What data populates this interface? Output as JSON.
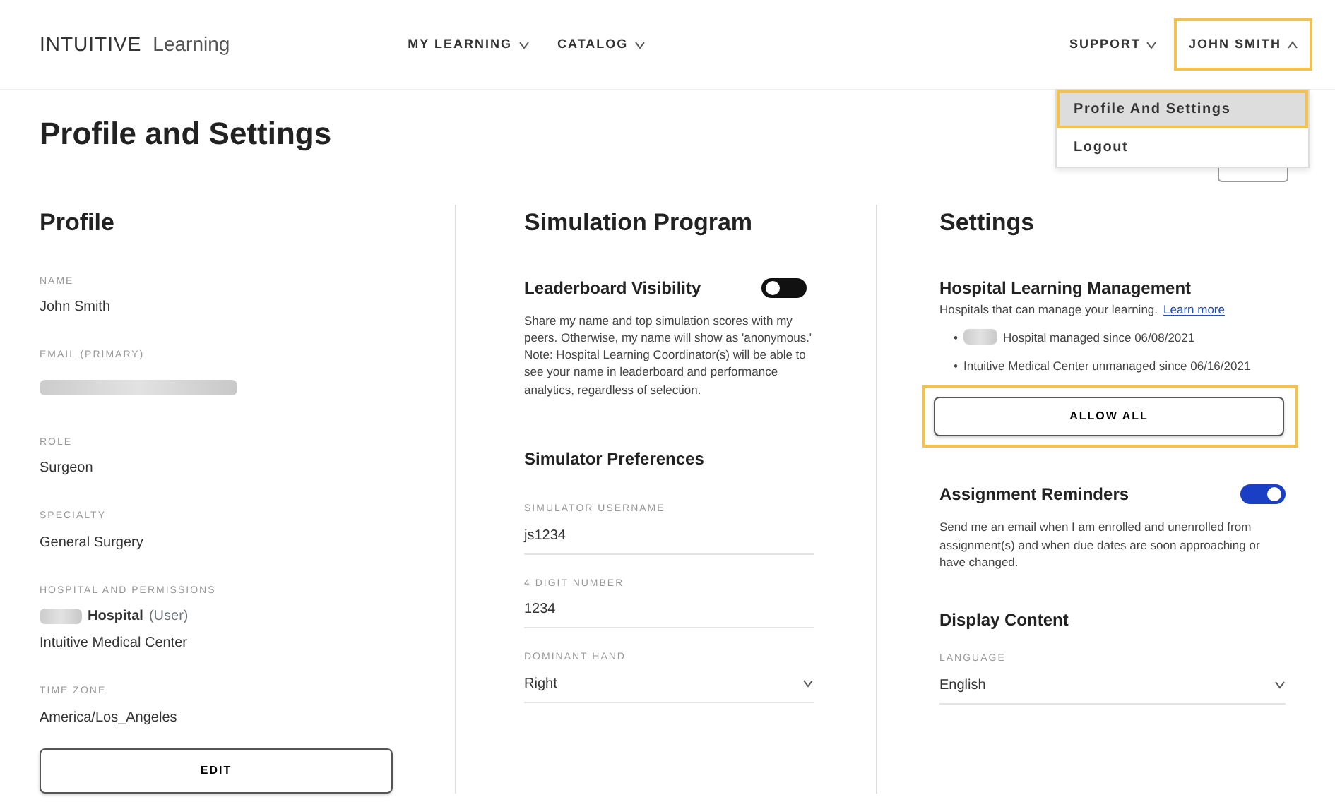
{
  "header": {
    "logo": {
      "brand": "INTUITIVE",
      "product": "Learning"
    },
    "nav": [
      {
        "label": "MY LEARNING",
        "expanded": false
      },
      {
        "label": "CATALOG",
        "expanded": false
      }
    ],
    "right_nav": [
      {
        "label": "SUPPORT",
        "expanded": false,
        "highlighted": false
      },
      {
        "label": "JOHN SMITH",
        "expanded": true,
        "highlighted": true
      }
    ],
    "user_menu": [
      {
        "label": "Profile And Settings",
        "selected": true
      },
      {
        "label": "Logout",
        "selected": false
      }
    ]
  },
  "page_title": "Profile and Settings",
  "profile": {
    "title": "Profile",
    "fields": [
      {
        "label": "NAME",
        "value": "John Smith",
        "redacted": false
      },
      {
        "label": "EMAIL (PRIMARY)",
        "redacted": true
      },
      {
        "label": "ROLE",
        "value": "Surgeon",
        "redacted": false
      },
      {
        "label": "SPECIALTY",
        "value": "General Surgery",
        "redacted": false
      },
      {
        "label": "HOSPITAL AND PERMISSIONS",
        "hospital": "Hospital",
        "permission": "(User)",
        "value": "Intuitive Medical Center",
        "redacted": true
      },
      {
        "label": "TIME ZONE",
        "value": "America/Los_Angeles",
        "redacted": false
      }
    ],
    "button": "EDIT"
  },
  "simulation": {
    "title": "Simulation Program",
    "leaderboard": {
      "title": "Leaderboard Visibility",
      "on": false,
      "description": "Share my name and top simulation scores with my peers. Otherwise, my name will show as 'anonymous.' Note: Hospital Learning Coordinator(s) will be able to see your name in leaderboard and performance analytics, regardless of selection."
    },
    "preferences_title": "Simulator Preferences",
    "fields": [
      {
        "kind": "text",
        "label": "SIMULATOR USERNAME",
        "value": "js1234"
      },
      {
        "kind": "text",
        "label": "4 DIGIT NUMBER",
        "value": "1234"
      },
      {
        "kind": "select",
        "label": "DOMINANT HAND",
        "value": "Right"
      }
    ]
  },
  "settings": {
    "title": "Settings",
    "hospital_management": {
      "title": "Hospital Learning Management",
      "subtitle": "Hospitals that can manage your learning.",
      "link": "Learn more",
      "items": [
        {
          "bullet": "•",
          "text": "Hospital managed since 06/08/2021",
          "redacted": true
        },
        {
          "bullet": "•",
          "text": "Intuitive Medical Center unmanaged since 06/16/2021",
          "redacted": false
        }
      ],
      "button": "ALLOW ALL",
      "highlighted": true
    },
    "reminders": {
      "title": "Assignment Reminders",
      "on": true,
      "description": "Send me an email when I am enrolled and unenrolled from assignment(s) and when due dates are soon approaching or have changed."
    },
    "display_title": "Display Content",
    "language": {
      "label": "LANGUAGE",
      "value": "English"
    }
  }
}
